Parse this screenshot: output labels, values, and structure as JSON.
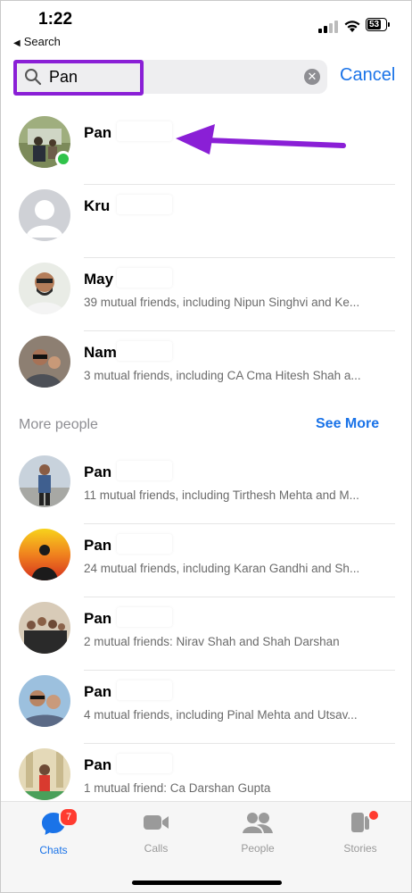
{
  "status": {
    "time": "1:22",
    "back_app": "Search",
    "battery": "53"
  },
  "search": {
    "value": "Pan",
    "cancel_label": "Cancel"
  },
  "results": [
    {
      "name": "Pan",
      "subtitle": "",
      "online": true
    },
    {
      "name": "Kru",
      "subtitle": "",
      "online": false
    },
    {
      "name": "May",
      "subtitle": "39 mutual friends, including Nipun Singhvi and Ke...",
      "online": false
    },
    {
      "name": "Nam",
      "subtitle": "3 mutual friends, including CA Cma Hitesh Shah a...",
      "online": false
    }
  ],
  "more_section": {
    "title": "More people",
    "see_more": "See More"
  },
  "more_people": [
    {
      "name": "Pan",
      "subtitle": "11 mutual friends, including Tirthesh Mehta and M..."
    },
    {
      "name": "Pan",
      "subtitle": "24 mutual friends, including Karan Gandhi and Sh..."
    },
    {
      "name": "Pan",
      "subtitle": "2 mutual friends: Nirav Shah and Shah Darshan"
    },
    {
      "name": "Pan",
      "subtitle": "4 mutual friends, including Pinal Mehta and Utsav..."
    },
    {
      "name": "Pan",
      "subtitle": "1 mutual friend: Ca Darshan Gupta"
    }
  ],
  "tabs": [
    {
      "label": "Chats",
      "badge": "7",
      "active": true
    },
    {
      "label": "Calls"
    },
    {
      "label": "People"
    },
    {
      "label": "Stories",
      "dot": true
    }
  ],
  "colors": {
    "accent": "#1a73e8",
    "highlight": "#8a1fd6",
    "online": "#30c34a",
    "badge": "#ff3b30"
  }
}
